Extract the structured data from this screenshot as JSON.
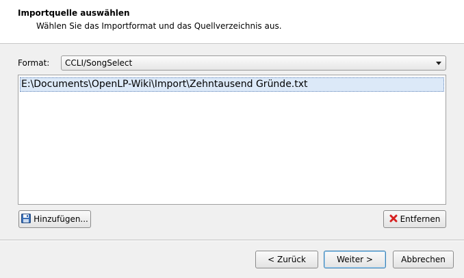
{
  "header": {
    "title": "Importquelle auswählen",
    "subtitle": "Wählen Sie das Importformat und das Quellverzeichnis aus."
  },
  "format": {
    "label": "Format:",
    "selected": "CCLI/SongSelect"
  },
  "file_list": {
    "items": [
      "E:\\Documents\\OpenLP-Wiki\\Import\\Zehntausend Gründe.txt"
    ]
  },
  "buttons": {
    "add": "Hinzufügen...",
    "remove": "Entfernen",
    "back": "< Zurück",
    "next": "Weiter >",
    "cancel": "Abbrechen"
  },
  "icons": {
    "add": "floppy-disk-icon",
    "remove": "red-x-icon"
  },
  "colors": {
    "selection": "#dce9f8",
    "remove_icon": "#d62020",
    "add_icon": "#3b6fb6"
  }
}
